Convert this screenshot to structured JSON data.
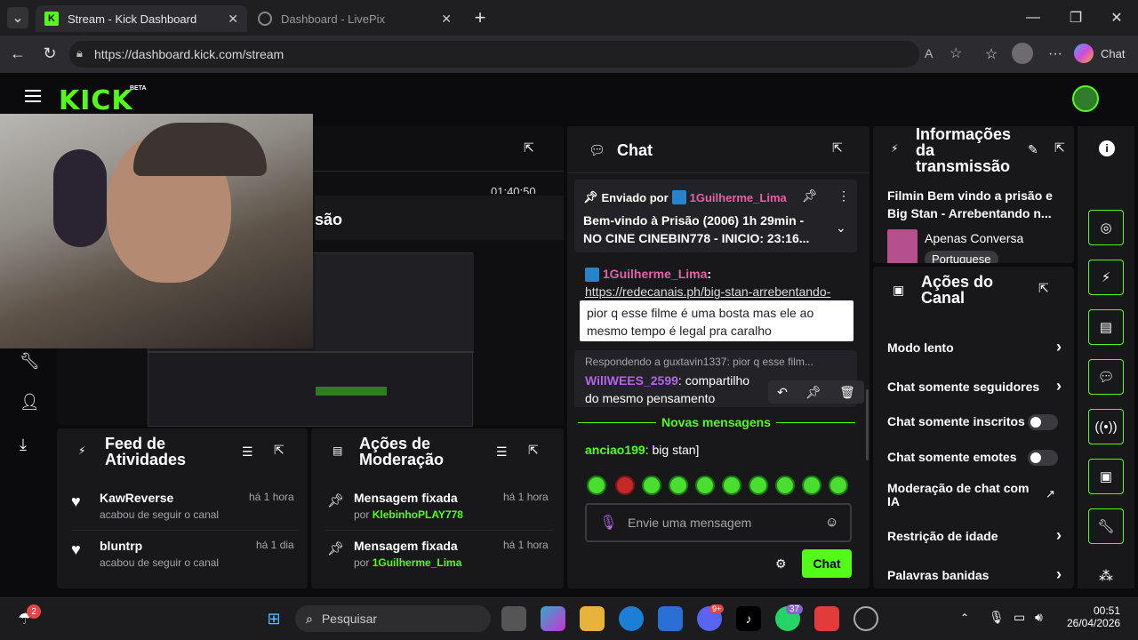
{
  "browser": {
    "tabs": [
      {
        "title": "Stream - Kick Dashboard",
        "active": true
      },
      {
        "title": "Dashboard - LivePix",
        "active": false
      }
    ],
    "url": "https://dashboard.kick.com/stream",
    "chat_button": "Chat"
  },
  "app": {
    "logo": "KICK",
    "logo_badge": "BETA"
  },
  "preview": {
    "partial_title": "são",
    "partial_time": "01:40:50"
  },
  "chat": {
    "title": "Chat",
    "pinned": {
      "by_label": "Enviado por",
      "user": "1Guilherme_Lima",
      "text": "Bem-vindo à Prisão (2006) 1h 29min - NO CINE CINEBIN778 - INICIO: 23:16..."
    },
    "messages": [
      {
        "user": "1Guilherme_Lima",
        "text": "https://redecanais.ph/big-stan-arrebentando-"
      },
      {
        "reply_to": "Respondendo a guxtavin1337: pior q esse film...",
        "user": "WillWEES_2599",
        "text": "compartilho do mesmo pensamento"
      },
      {
        "user": "anciao199",
        "text": "big stan]"
      }
    ],
    "tooltip": "pior q esse filme é uma bosta mas ele ao mesmo tempo é legal pra caralho",
    "new_messages": "Novas mensagens",
    "input_placeholder": "Envie uma mensagem",
    "send_button": "Chat"
  },
  "stream_info": {
    "title": "Informações da transmissão",
    "stream_title": "Filmin Bem vindo a prisão e Big Stan - Arrebentando n...",
    "category": "Apenas Conversa",
    "language": "Portuguese"
  },
  "channel_actions": {
    "title": "Ações do Canal",
    "items": [
      {
        "label": "Modo lento",
        "control": "chevron"
      },
      {
        "label": "Chat somente seguidores",
        "control": "chevron"
      },
      {
        "label": "Chat somente inscritos",
        "control": "toggle"
      },
      {
        "label": "Chat somente emotes",
        "control": "toggle"
      },
      {
        "label": "Moderação de chat com IA",
        "control": "external"
      },
      {
        "label": "Restrição de idade",
        "control": "chevron"
      },
      {
        "label": "Palavras banidas",
        "control": "chevron"
      }
    ]
  },
  "activity_feed": {
    "title": "Feed de Atividades",
    "items": [
      {
        "user": "KawReverse",
        "action": "acabou de seguir o canal",
        "time": "há 1 hora"
      },
      {
        "user": "bluntrp",
        "action": "acabou de seguir o canal",
        "time": "há 1 dia"
      }
    ]
  },
  "mod_actions": {
    "title": "Ações de Moderação",
    "items": [
      {
        "action": "Mensagem fixada",
        "by_prefix": "por",
        "user": "KlebinhoPLAY778",
        "time": "há 1 hora"
      },
      {
        "action": "Mensagem fixada",
        "by_prefix": "por",
        "user": "1Guilherme_Lima",
        "time": "há 1 hora"
      }
    ]
  },
  "taskbar": {
    "search_placeholder": "Pesquisar",
    "weather_badge": "2",
    "discord_badge": "9+",
    "whatsapp_badge": "37",
    "time": "00:51",
    "date": "26/04/2026"
  },
  "colors": {
    "accent": "#53fc18",
    "username_pink": "#e75fa7",
    "panel": "#18181b"
  }
}
